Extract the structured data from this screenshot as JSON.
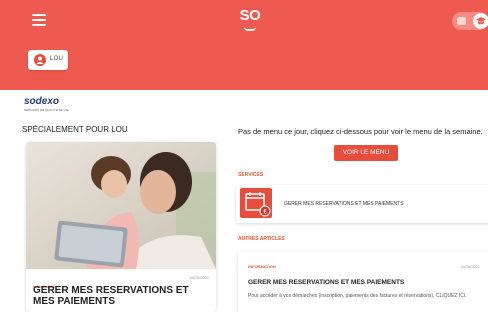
{
  "header": {
    "logo_text": "SO",
    "user_name": "LOU"
  },
  "brand": {
    "name": "sodexo",
    "tagline": "SERVICES DE QUALITÉ DE VIE"
  },
  "left": {
    "heading_prefix": "SPÉCIALEMENT POUR",
    "heading_user": "LOU",
    "card": {
      "category": "Information",
      "date": "19/08/2021",
      "title": "GERER MES RESERVATIONS ET MES PAIEMENTS"
    }
  },
  "right": {
    "no_menu_text": "Pas de menu ce jour, cliquez ci-dessous pour voir le menu de la semaine.",
    "menu_button": "VOIR LE MENU",
    "services_label": "SERVICES",
    "service_item": "GERER MES RESERVATIONS ET MES PAIEMENTS",
    "other_label": "AUTRES ARTICLES",
    "article": {
      "category": "INFORMATION",
      "date": "19/08/2021",
      "title": "GERER MES RESERVATIONS ET MES PAIEMENTS",
      "body": "Pour accéder à vos démarches (inscription, paiements des factures et réservations), CLIQUEZ ICI."
    }
  },
  "icons": {
    "menu": "hamburger-menu-icon",
    "toggle": "theme-toggle",
    "user": "user-icon",
    "calendar": "calendar-euro-icon"
  },
  "colors": {
    "brand_red": "#ee5a4f",
    "button_red": "#e84c3d",
    "label_orange": "#e85a3b",
    "sodexo_blue": "#2a3a6d"
  }
}
